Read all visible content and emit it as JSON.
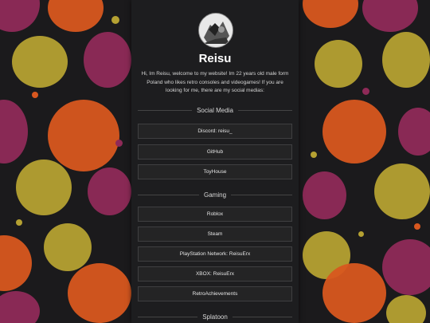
{
  "profile": {
    "name": "Reisu",
    "bio": "Hi, Im Reisu, welcome to my website! Im 22 years old male form Poland who likes retro consoles and videogames! If you are looking for me, there are my social medias:"
  },
  "sections": [
    {
      "title": "Social Media",
      "links": [
        "Discord: reisu_",
        "GitHub",
        "ToyHouse"
      ]
    },
    {
      "title": "Gaming",
      "links": [
        "Roblox",
        "Steam",
        "PlayStation Network: ReisuErx",
        "XBOX: ReisuErx",
        "RetroAchievements"
      ]
    },
    {
      "title": "Splatoon",
      "links": []
    }
  ],
  "colors": {
    "panel": "#1d1d1f",
    "button_bg": "#242425",
    "button_border": "#3f3f41",
    "splat_orange": "#d8571f",
    "splat_purple": "#8f2a58",
    "splat_yellow": "#b5a132"
  },
  "icons": {
    "avatar": "avatar-image"
  }
}
